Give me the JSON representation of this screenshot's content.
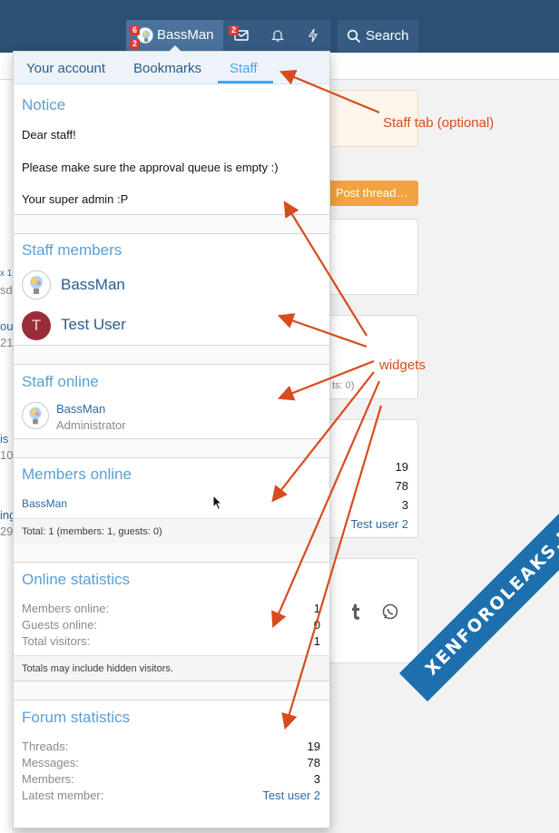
{
  "navbar": {
    "username": "BassMan",
    "alerts_badge": "6",
    "account_badge": "2",
    "inbox_badge": "2",
    "search_label": "Search",
    "icons": [
      "inbox-icon",
      "bell-icon",
      "bolt-icon",
      "search-icon"
    ]
  },
  "menu": {
    "tabs": [
      "Your account",
      "Bookmarks",
      "Staff"
    ],
    "active_tab": "Staff",
    "notice": {
      "title": "Notice",
      "lines": [
        "Dear staff!",
        "Please make sure the approval queue is empty :)",
        "Your super admin :P"
      ]
    },
    "staff_members": {
      "title": "Staff members",
      "members": [
        {
          "name": "BassMan",
          "avatar": "bulb-avatar"
        },
        {
          "name": "Test User",
          "avatar_letter": "T"
        }
      ]
    },
    "staff_online": {
      "title": "Staff online",
      "name": "BassMan",
      "role": "Administrator"
    },
    "members_online": {
      "title": "Members online",
      "name": "BassMan",
      "footer": "Total: 1 (members: 1, guests: 0)"
    },
    "online_statistics": {
      "title": "Online statistics",
      "rows": [
        {
          "label": "Members online:",
          "value": "1"
        },
        {
          "label": "Guests online:",
          "value": "0"
        },
        {
          "label": "Total visitors:",
          "value": "1"
        }
      ],
      "footer": "Totals may include hidden visitors."
    },
    "forum_statistics": {
      "title": "Forum statistics",
      "rows": [
        {
          "label": "Threads:",
          "value": "19"
        },
        {
          "label": "Messages:",
          "value": "78"
        },
        {
          "label": "Members:",
          "value": "3"
        },
        {
          "label": "Latest member:",
          "value": "Test user 2"
        }
      ]
    }
  },
  "background": {
    "post_thread": "Post thread…",
    "online_fragment": "ts: 0)",
    "stats": [
      "19",
      "78",
      "3"
    ],
    "latest_member": "Test user 2",
    "left_fragments": [
      "x 1",
      "sda",
      "ou",
      "21",
      "is",
      "10",
      "ing",
      "29"
    ]
  },
  "annotations": {
    "staff_tab": "Staff tab (optional)",
    "widgets": "widgets"
  },
  "watermark": "XENFOROLEAKS.NET",
  "colors": {
    "navbar": "#2c5074",
    "accent_blue": "#47a7eb",
    "widget_title": "#5a9fd4",
    "link": "#2d6aa6",
    "annotation": "#d84b1e",
    "post_button": "#f0a33e"
  }
}
